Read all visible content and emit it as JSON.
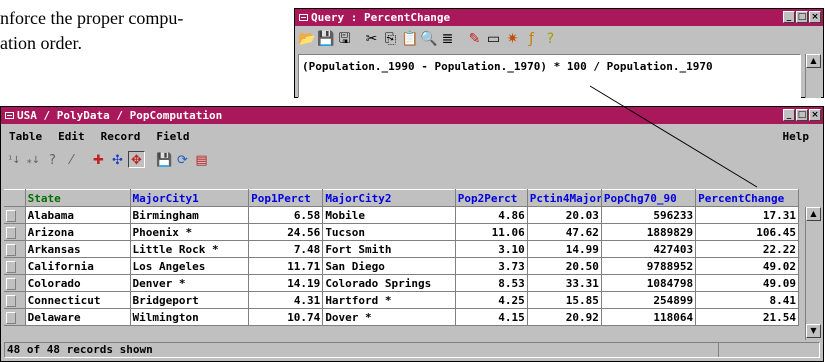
{
  "doc": {
    "line1": "nforce the proper compu-",
    "line2": "ation order."
  },
  "query": {
    "title": "Query : PercentChange",
    "expression": "(Population._1990 - Population._1970) * 100 / Population._1970"
  },
  "table": {
    "title": "USA / PolyData / PopComputation",
    "menu": [
      "Table",
      "Edit",
      "Record",
      "Field"
    ],
    "help": "Help",
    "columns": [
      "State",
      "MajorCity1",
      "Pop1Perct",
      "MajorCity2",
      "Pop2Perct",
      "Pctin4Major",
      "PopChg70_90",
      "PercentChange"
    ],
    "rows": [
      [
        "Alabama",
        "Birmingham",
        "6.58",
        "Mobile",
        "4.86",
        "20.03",
        "596233",
        "17.31"
      ],
      [
        "Arizona",
        "Phoenix *",
        "24.56",
        "Tucson",
        "11.06",
        "47.62",
        "1889829",
        "106.45"
      ],
      [
        "Arkansas",
        "Little Rock *",
        "7.48",
        "Fort Smith",
        "3.10",
        "14.99",
        "427403",
        "22.22"
      ],
      [
        "California",
        "Los Angeles",
        "11.71",
        "San Diego",
        "3.73",
        "20.50",
        "9788952",
        "49.02"
      ],
      [
        "Colorado",
        "Denver *",
        "14.19",
        "Colorado Springs",
        "8.53",
        "33.31",
        "1084798",
        "49.09"
      ],
      [
        "Connecticut",
        "Bridgeport",
        "4.31",
        "Hartford *",
        "4.25",
        "15.85",
        "254899",
        "8.41"
      ],
      [
        "Delaware",
        "Wilmington",
        "10.74",
        "Dover *",
        "4.15",
        "20.92",
        "118064",
        "21.54"
      ]
    ],
    "status": "48 of 48 records shown"
  },
  "colors": {
    "titlebar": "#a8185a",
    "frame": "#c0c0c0",
    "header_text": "#0000e0",
    "state_header": "#007000"
  },
  "icons": {
    "query_toolbar": [
      "open-icon",
      "save-icon",
      "save-as-icon",
      "cut-icon",
      "copy-icon",
      "paste-icon",
      "find-icon",
      "insert-field-icon",
      "wizard-icon",
      "window-icon",
      "star-icon",
      "function-icon",
      "help-icon"
    ],
    "table_toolbar": [
      "sort-ascending-icon",
      "sort-menu-icon",
      "query-icon",
      "filter-icon",
      "tag-icon",
      "select-all-icon",
      "select-tagged-icon",
      "save-table-icon",
      "relations-icon",
      "new-record-icon"
    ]
  }
}
